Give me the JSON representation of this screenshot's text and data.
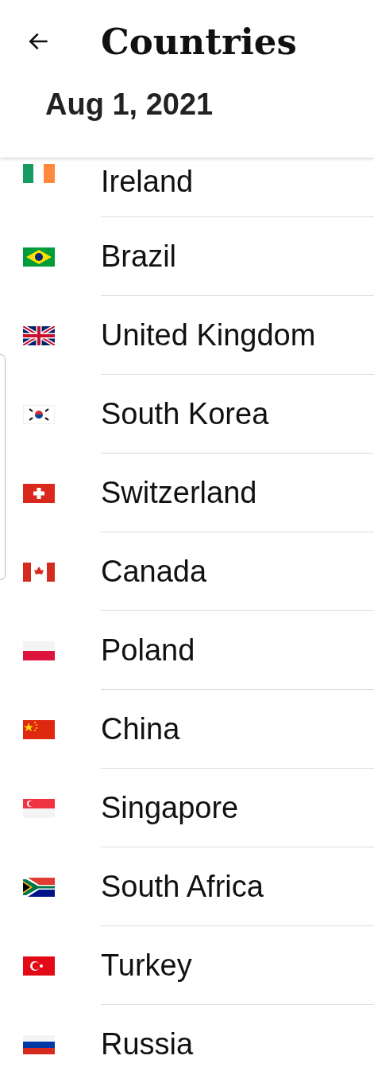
{
  "header": {
    "title": "Countries",
    "date": "Aug 1, 2021"
  },
  "countries": [
    {
      "name": "Ireland",
      "kind": "ireland"
    },
    {
      "name": "Brazil",
      "kind": "brazil"
    },
    {
      "name": "United Kingdom",
      "kind": "uk"
    },
    {
      "name": "South Korea",
      "kind": "korea"
    },
    {
      "name": "Switzerland",
      "kind": "swiss"
    },
    {
      "name": "Canada",
      "kind": "canada"
    },
    {
      "name": "Poland",
      "kind": "poland"
    },
    {
      "name": "China",
      "kind": "china"
    },
    {
      "name": "Singapore",
      "kind": "singapore"
    },
    {
      "name": "South Africa",
      "kind": "southafrica"
    },
    {
      "name": "Turkey",
      "kind": "turkey"
    },
    {
      "name": "Russia",
      "kind": "russia"
    }
  ]
}
